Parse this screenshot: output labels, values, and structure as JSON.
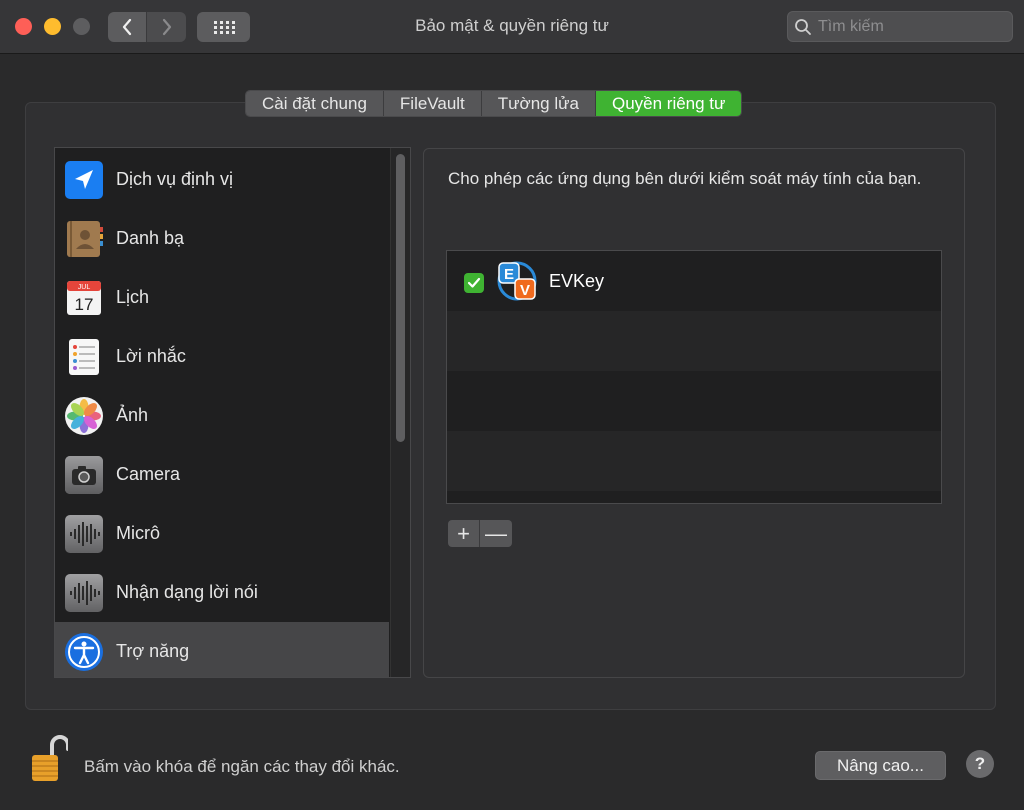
{
  "window": {
    "title": "Bảo mật & quyền riêng tư",
    "search_placeholder": "Tìm kiếm"
  },
  "tabs": [
    {
      "label": "Cài đặt chung",
      "active": false
    },
    {
      "label": "FileVault",
      "active": false
    },
    {
      "label": "Tường lửa",
      "active": false
    },
    {
      "label": "Quyền riêng tư",
      "active": true
    }
  ],
  "sidebar": {
    "items": [
      {
        "label": "Dịch vụ định vị",
        "icon": "location-arrow-icon"
      },
      {
        "label": "Danh bạ",
        "icon": "contacts-book-icon"
      },
      {
        "label": "Lịch",
        "icon": "calendar-icon",
        "icon_text": {
          "month": "JUL",
          "day": "17"
        }
      },
      {
        "label": "Lời nhắc",
        "icon": "reminders-icon"
      },
      {
        "label": "Ảnh",
        "icon": "photos-icon"
      },
      {
        "label": "Camera",
        "icon": "camera-icon"
      },
      {
        "label": "Micrô",
        "icon": "microphone-waveform-icon"
      },
      {
        "label": "Nhận dạng lời nói",
        "icon": "speech-waveform-icon"
      },
      {
        "label": "Trợ năng",
        "icon": "accessibility-icon",
        "selected": true
      }
    ]
  },
  "detail": {
    "description": "Cho phép các ứng dụng bên dưới kiểm soát máy tính của bạn.",
    "apps": [
      {
        "name": "EVKey",
        "checked": true,
        "icon": "evkey-icon",
        "icon_letters": [
          "E",
          "V"
        ]
      }
    ],
    "add_label": "+",
    "remove_label": "—"
  },
  "footer": {
    "lock_message": "Bấm vào khóa để ngăn các thay đổi khác.",
    "advanced_label": "Nâng cao...",
    "help_label": "?"
  },
  "colors": {
    "accent_green": "#3fb332",
    "background": "#2a2a2b"
  }
}
